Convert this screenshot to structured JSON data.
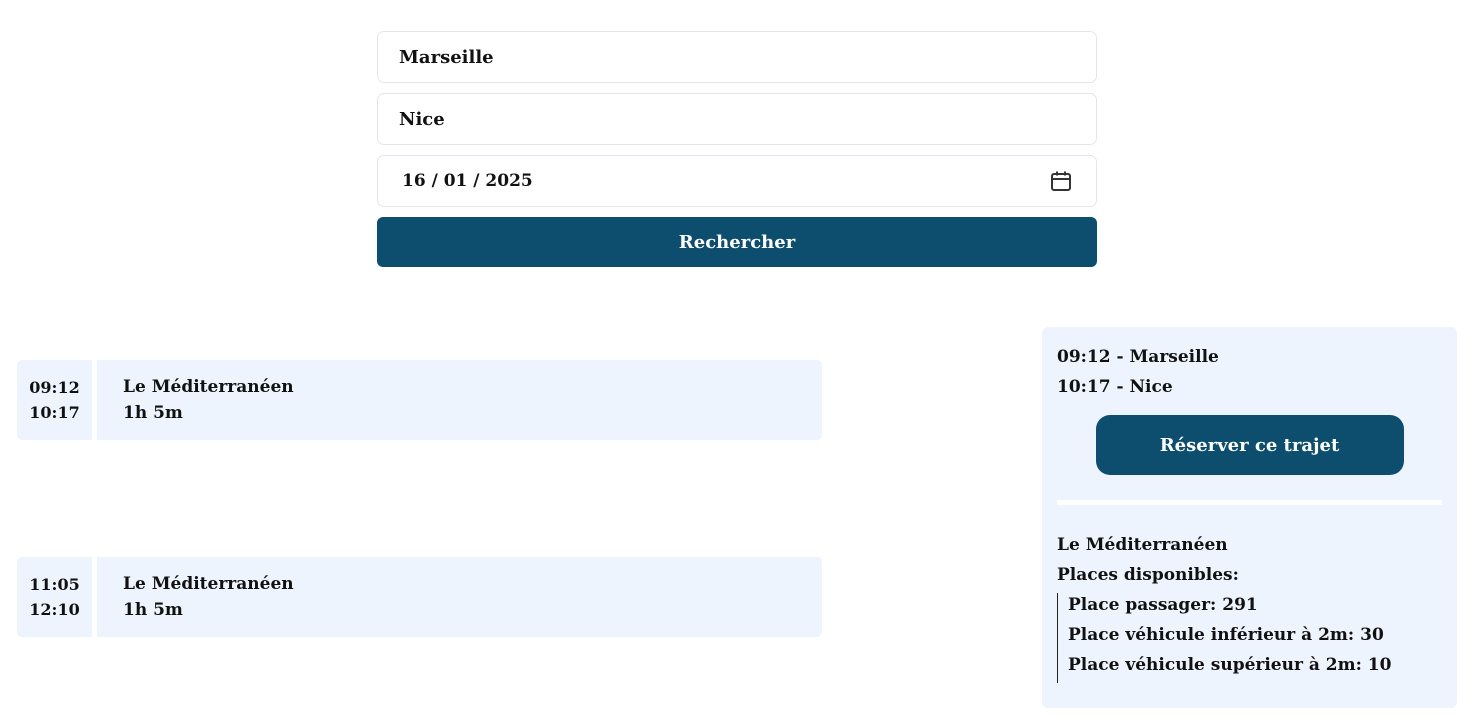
{
  "search": {
    "departure": "Marseille",
    "arrival": "Nice",
    "date": "16 / 01 / 2025",
    "button_label": "Rechercher"
  },
  "trips": [
    {
      "depart_time": "09:12",
      "arrive_time": "10:17",
      "ship": "Le Méditerranéen",
      "duration": "1h 5m"
    },
    {
      "depart_time": "11:05",
      "arrive_time": "12:10",
      "ship": "Le Méditerranéen",
      "duration": "1h 5m"
    }
  ],
  "detail": {
    "departure_line": "09:12 - Marseille",
    "arrival_line": "10:17 - Nice",
    "reserve_label": "Réserver ce trajet",
    "ship": "Le Méditerranéen",
    "places_heading": "Places disponibles:",
    "places": [
      "Place passager: 291",
      "Place véhicule inférieur à 2m: 30",
      "Place véhicule supérieur à 2m: 10"
    ]
  },
  "colors": {
    "primary": "#0d4e6e",
    "card_bg": "#edf4fe",
    "border": "#e3e6ea"
  },
  "icons": {
    "date_field": "calendar-icon"
  }
}
